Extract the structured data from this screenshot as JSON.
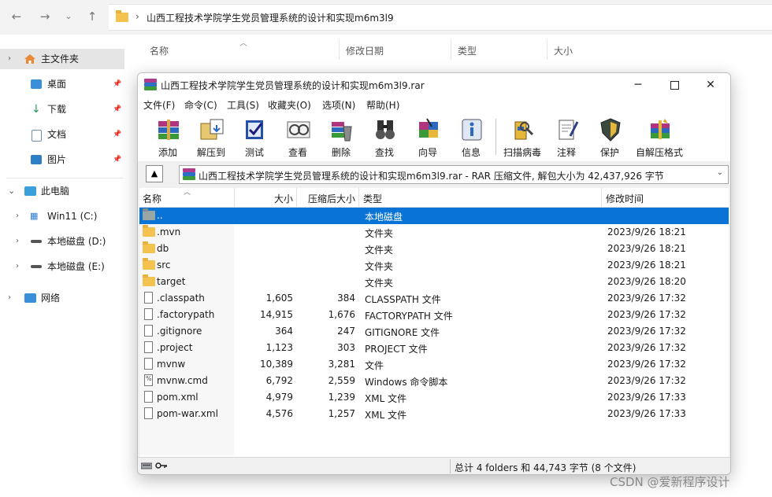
{
  "explorer": {
    "path": "山西工程技术学院学生党员管理系统的设计和实现m6m3l9",
    "columns": [
      "名称",
      "修改日期",
      "类型",
      "大小"
    ],
    "sidebar": [
      {
        "label": "主文件夹",
        "icon": "home-icon"
      },
      {
        "label": "桌面",
        "icon": "desktop-icon"
      },
      {
        "label": "下载",
        "icon": "download-icon"
      },
      {
        "label": "文档",
        "icon": "document-icon"
      },
      {
        "label": "图片",
        "icon": "picture-icon"
      },
      {
        "label": "此电脑",
        "icon": "computer-icon"
      },
      {
        "label": "Win11 (C:)",
        "icon": "windows-drive-icon"
      },
      {
        "label": "本地磁盘 (D:)",
        "icon": "drive-icon"
      },
      {
        "label": "本地磁盘 (E:)",
        "icon": "drive-icon"
      },
      {
        "label": "网络",
        "icon": "network-icon"
      }
    ]
  },
  "winrar": {
    "title": "山西工程技术学院学生党员管理系统的设计和实现m6m3l9.rar",
    "menu": [
      "文件(F)",
      "命令(C)",
      "工具(S)",
      "收藏夹(O)",
      "选项(N)",
      "帮助(H)"
    ],
    "toolbar": [
      {
        "label": "添加",
        "icon": "add-archive-icon"
      },
      {
        "label": "解压到",
        "icon": "extract-to-icon"
      },
      {
        "label": "测试",
        "icon": "test-icon"
      },
      {
        "label": "查看",
        "icon": "view-icon"
      },
      {
        "label": "删除",
        "icon": "delete-icon"
      },
      {
        "label": "查找",
        "icon": "find-icon"
      },
      {
        "label": "向导",
        "icon": "wizard-icon"
      },
      {
        "label": "信息",
        "icon": "info-icon"
      },
      {
        "label": "扫描病毒",
        "icon": "virus-scan-icon"
      },
      {
        "label": "注释",
        "icon": "comment-icon"
      },
      {
        "label": "保护",
        "icon": "protect-icon"
      },
      {
        "label": "自解压格式",
        "icon": "sfx-icon"
      }
    ],
    "archive_path": "山西工程技术学院学生党员管理系统的设计和实现m6m3l9.rar - RAR 压缩文件, 解包大小为 42,437,926 字节",
    "columns": [
      "名称",
      "大小",
      "压缩后大小",
      "类型",
      "修改时间"
    ],
    "files": [
      {
        "name": "..",
        "size": "",
        "packed": "",
        "type": "本地磁盘",
        "modified": "",
        "kind": "up"
      },
      {
        "name": ".mvn",
        "size": "",
        "packed": "",
        "type": "文件夹",
        "modified": "2023/9/26 18:21",
        "kind": "folder"
      },
      {
        "name": "db",
        "size": "",
        "packed": "",
        "type": "文件夹",
        "modified": "2023/9/26 18:21",
        "kind": "folder"
      },
      {
        "name": "src",
        "size": "",
        "packed": "",
        "type": "文件夹",
        "modified": "2023/9/26 18:21",
        "kind": "folder"
      },
      {
        "name": "target",
        "size": "",
        "packed": "",
        "type": "文件夹",
        "modified": "2023/9/26 18:20",
        "kind": "folder"
      },
      {
        "name": ".classpath",
        "size": "1,605",
        "packed": "384",
        "type": "CLASSPATH 文件",
        "modified": "2023/9/26 17:32",
        "kind": "file"
      },
      {
        "name": ".factorypath",
        "size": "14,915",
        "packed": "1,676",
        "type": "FACTORYPATH 文件",
        "modified": "2023/9/26 17:32",
        "kind": "file"
      },
      {
        "name": ".gitignore",
        "size": "364",
        "packed": "247",
        "type": "GITIGNORE 文件",
        "modified": "2023/9/26 17:32",
        "kind": "file"
      },
      {
        "name": ".project",
        "size": "1,123",
        "packed": "303",
        "type": "PROJECT 文件",
        "modified": "2023/9/26 17:32",
        "kind": "file"
      },
      {
        "name": "mvnw",
        "size": "10,389",
        "packed": "3,281",
        "type": "文件",
        "modified": "2023/9/26 17:32",
        "kind": "file"
      },
      {
        "name": "mvnw.cmd",
        "size": "6,792",
        "packed": "2,559",
        "type": "Windows 命令脚本",
        "modified": "2023/9/26 17:32",
        "kind": "cmd"
      },
      {
        "name": "pom.xml",
        "size": "4,979",
        "packed": "1,239",
        "type": "XML 文件",
        "modified": "2023/9/26 17:33",
        "kind": "file"
      },
      {
        "name": "pom-war.xml",
        "size": "4,576",
        "packed": "1,257",
        "type": "XML 文件",
        "modified": "2023/9/26 17:33",
        "kind": "file"
      }
    ],
    "status": "总计 4 folders 和 44,743 字节 (8 个文件)"
  },
  "watermark": "CSDN @爱新程序设计"
}
